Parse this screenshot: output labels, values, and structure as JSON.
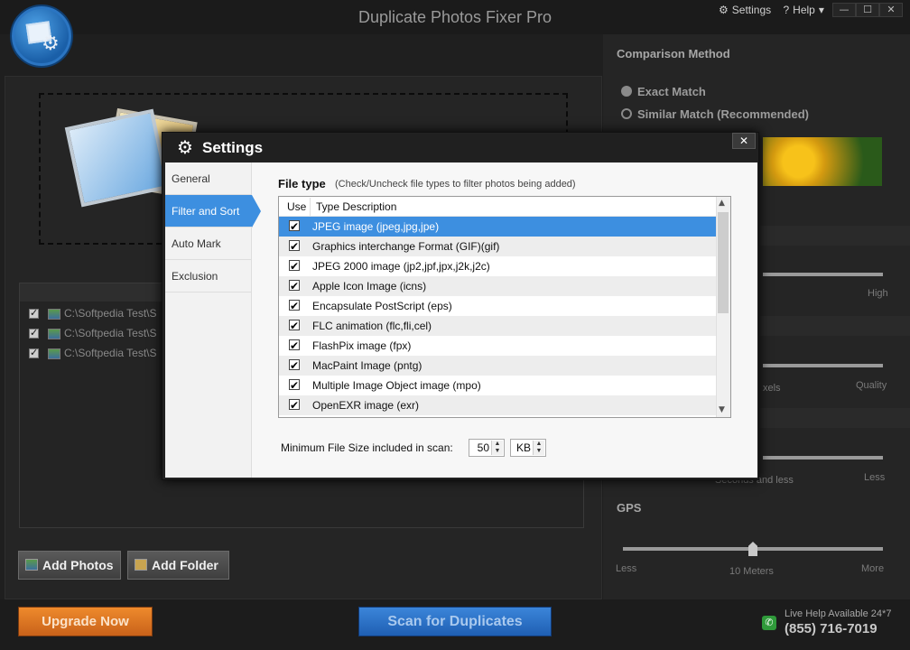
{
  "app": {
    "title": "Duplicate Photos Fixer Pro",
    "settings_link": "Settings",
    "help_link": "Help",
    "minimize": "—",
    "maximize": "☐",
    "close": "✕"
  },
  "left": {
    "files": [
      "C:\\Softpedia Test\\S",
      "C:\\Softpedia Test\\S",
      "C:\\Softpedia Test\\S"
    ],
    "add_photos": "Add Photos",
    "add_folder": "Add Folder"
  },
  "right": {
    "comparison_title": "Comparison Method",
    "exact_match": "Exact Match",
    "similar_match": "Similar Match (Recommended)",
    "slider1_right": "High",
    "slider2_left": "xels",
    "slider2_right": "Quality",
    "slider3_left": "Seconds and less",
    "slider3_right": "Less",
    "gps_title": "GPS",
    "gps_less": "Less",
    "gps_value": "10 Meters",
    "gps_more": "More"
  },
  "bottom": {
    "upgrade": "Upgrade Now",
    "scan": "Scan for Duplicates",
    "help_text": "Live Help Available 24*7",
    "phone": "(855) 716-7019"
  },
  "dialog": {
    "title": "Settings",
    "close": "✕",
    "nav": [
      "General",
      "Filter and Sort",
      "Auto Mark",
      "Exclusion"
    ],
    "filetype_title": "File type",
    "filetype_hint": "(Check/Uncheck file types to filter photos being added)",
    "col_use": "Use",
    "col_desc": "Type Description",
    "rows": [
      "JPEG image (jpeg,jpg,jpe)",
      "Graphics interchange Format (GIF)(gif)",
      "JPEG 2000 image (jp2,jpf,jpx,j2k,j2c)",
      "Apple Icon Image (icns)",
      "Encapsulate PostScript (eps)",
      "FLC animation (flc,fli,cel)",
      "FlashPix image (fpx)",
      "MacPaint Image (pntg)",
      "Multiple Image Object image (mpo)",
      "OpenEXR image (exr)"
    ],
    "min_size_label": "Minimum File Size included in scan:",
    "min_size_value": "50",
    "min_size_unit": "KB"
  },
  "colors": {
    "accent": "#3d8fe0",
    "upgrade": "#e07a24",
    "scan": "#2d72c8"
  }
}
